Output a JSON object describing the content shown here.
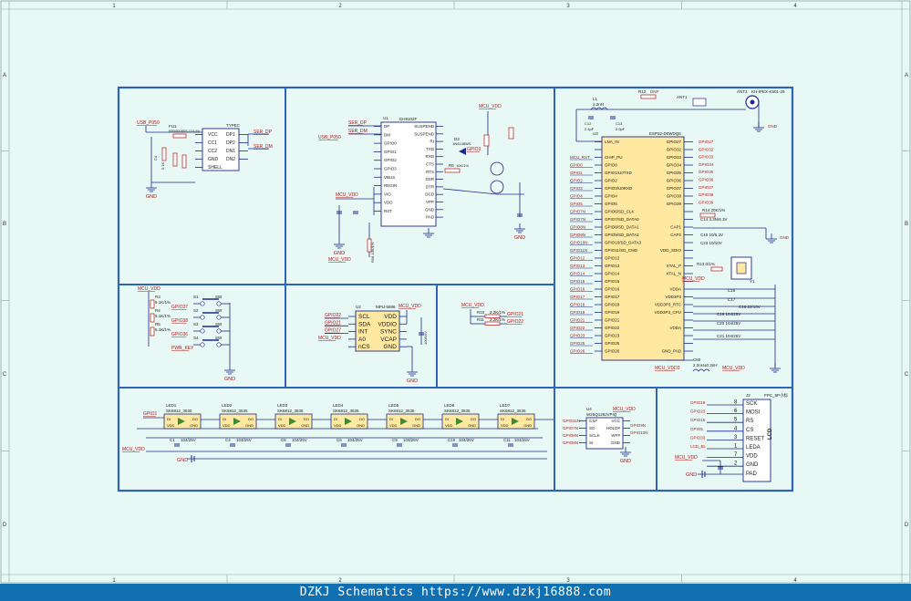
{
  "zones": {
    "columns": [
      "1",
      "2",
      "3",
      "4"
    ],
    "rows": [
      "A",
      "B",
      "C",
      "D"
    ]
  },
  "colors": {
    "background": "#e8f8f5",
    "frame": "#2f63b8",
    "wire": "#1c2a8c",
    "net_label": "#b01818",
    "chip_fill": "#ffe8a0",
    "footer_bg": "#0f6fb0"
  },
  "usb": {
    "connector_ref": "TYPEC",
    "pins_left": [
      "VCC",
      "CC1",
      "CC2",
      "GND",
      "SHELL"
    ],
    "pins_right": [
      "DP1",
      "DP2",
      "DN1",
      "DN2"
    ],
    "net_power": "USB_P050",
    "fuse_ref": "FU1",
    "fuse_part": "BSMD0805-110-6V",
    "net_dp": "SER_DP",
    "net_dm": "SER_DM",
    "gnd": "GND"
  },
  "ch9102": {
    "ref": "U1",
    "part": "CH9102F",
    "pins_left": [
      "DP",
      "DM",
      "GPIO0",
      "GPIO1",
      "GPIO2",
      "GPIO3",
      "VBUS",
      "REGIN",
      "VIO",
      "VDD",
      "RST"
    ],
    "pins_right": [
      "SUSPEND",
      "SUSPEND",
      "RI",
      "TXD",
      "RXD",
      "CTS",
      "RTS",
      "DSR",
      "DTR",
      "DCD",
      "VPP",
      "GND",
      "PAD"
    ],
    "net_dp": "SER_DP",
    "net_dm": "SER_DM",
    "net_power": "USB_P050",
    "net_vdd": "MCU_VDD",
    "diode_ref": "D3",
    "diode_part": "1N4148WS",
    "r_ref": "R6",
    "r_val": "10K/1%",
    "reset_r": "R58 10K/1%",
    "gnd": "GND"
  },
  "buttons": {
    "net_vdd": "MCU_VDD",
    "rows": [
      {
        "r": "R3",
        "rv": "5.1K/1%",
        "s": "S1",
        "net": "GPIO37",
        "label": "SW"
      },
      {
        "r": "R4",
        "rv": "5.1K/1%",
        "s": "S2",
        "net": "GPIO38",
        "label": "SW"
      },
      {
        "r": "R5",
        "rv": "5.1K/1%",
        "s": "S3",
        "net": "GPIO36",
        "label": "SW"
      },
      {
        "r": "",
        "rv": "",
        "s": "S4",
        "net": "PWR_KEY",
        "label": "SW"
      }
    ],
    "gnd": "GND"
  },
  "mpu": {
    "ref": "U2",
    "part": "MPU-6886",
    "pins_left": [
      "SCL",
      "SDA",
      "INT",
      "A0",
      "nCS"
    ],
    "pins_right": [
      "VDD",
      "VDDIO",
      "SYNC",
      "VCAP",
      "GND"
    ],
    "nets_left": [
      "GPIO22",
      "GPIO21",
      "GPIO27",
      "MCU_VDD"
    ],
    "net_vdd": "MCU_VDD",
    "cap": "100/10V",
    "gnd": "GND"
  },
  "i2c_pullups": {
    "net_vdd": "MCU_VDD",
    "rows": [
      {
        "r": "R10",
        "v": "2.2K/1%",
        "net": "GPIO21"
      },
      {
        "r": "R11",
        "v": "2.2K/1%",
        "net": "GPIO22"
      }
    ]
  },
  "esp32": {
    "ref": "U3",
    "part": "ESP32-D0WDQ6",
    "pins_left": [
      "LNA_IN",
      "",
      "CHIP_PU",
      "GPIO0",
      "GPIO1/U0TXD",
      "GPIO2",
      "GPIO3/U0RXD",
      "GPIO4",
      "GPIO5",
      "GPIO6/SD_CLK",
      "GPIO7/SD_DATA0",
      "GPIO8/SD_DATA1",
      "GPIO9/SD_DATA2",
      "GPIO10/SD_DATA3",
      "GPIO11/SD_CMD",
      "GPIO12",
      "GPIO13",
      "GPIO14",
      "GPIO15",
      "GPIO16",
      "GPIO17",
      "GPIO18",
      "GPIO19",
      "GPIO21",
      "GPIO22",
      "GPIO23",
      "GPIO25",
      "GPIO26"
    ],
    "nets_left": [
      "",
      "",
      "MCU_RST",
      "GPIO0",
      "GPIO1",
      "GPIO2",
      "GPIO3",
      "GPIO4",
      "GPIO5",
      "GPIO7N",
      "GPIO7N",
      "GPIO8N",
      "GPIO9N",
      "GPIO10N",
      "GPIO11N",
      "GPIO12",
      "GPIO13",
      "GPIO14",
      "GPIO15",
      "GPIO16",
      "GPIO17",
      "GPIO18",
      "GPIO19",
      "GPIO21",
      "GPIO22",
      "GPIO23",
      "GPIO25",
      "GPIO26"
    ],
    "pins_right": [
      "GPIO27",
      "GPIO32",
      "GPIO33",
      "GPIO34",
      "GPIO35",
      "GPIO36",
      "GPIO37",
      "GPIO38",
      "GPIO39",
      "",
      "",
      "CAP1",
      "CAP2",
      "",
      "VDD_SDIO",
      "",
      "XTAL_P",
      "XTAL_N",
      "",
      "VDDA",
      "VDD3P3",
      "VDD3P3_RTC",
      "VDD3P3_CPU",
      "",
      "VDDA",
      "",
      "",
      "GND_PAD"
    ],
    "nets_right": [
      "GPIO27",
      "GPIO32",
      "GPIO33",
      "GPIO34",
      "GPIO35",
      "GPIO36",
      "GPIO37",
      "GPIO38",
      "GPIO39"
    ],
    "passives": [
      "R14 20K/1%",
      "C14 3.3N/6.3V",
      "C15 10/6.3V",
      "C23 10/10V",
      "R13 0/1%",
      "C16",
      "C17",
      "C18 22/10V",
      "C19 104/25V",
      "C20 104/25V",
      "C21 104/25V",
      "C80",
      "2.2nH±0.3nH",
      "L1",
      "2.2nH",
      "C12",
      "2.4pF",
      "C13",
      "2.0pF",
      "R12",
      "DNP",
      "ANT1",
      "ANT2",
      "KH-IPEX-K501-29",
      "Y1"
    ],
    "net_vdd": "MCU_VDD",
    "net_vdd3": "MCU_VDD3",
    "gnd": "GND"
  },
  "leds": {
    "net_in": "GPIO1",
    "net_vdd": "MCU_VDD",
    "part": "SK6812_3535",
    "pins": [
      "DI",
      "DO",
      "VDD",
      "GND"
    ],
    "items": [
      {
        "ref": "LED1",
        "cap": "C1",
        "cv": "104/25V"
      },
      {
        "ref": "LED2",
        "cap": "C4",
        "cv": "104/25V"
      },
      {
        "ref": "LED3",
        "cap": "C5",
        "cv": "104/25V"
      },
      {
        "ref": "LED4",
        "cap": "C6",
        "cv": "104/25V"
      },
      {
        "ref": "LED5",
        "cap": "C9",
        "cv": "104/25V"
      },
      {
        "ref": "LED6",
        "cap": "C10",
        "cv": "104/25V"
      },
      {
        "ref": "LED7",
        "cap": "C11",
        "cv": "104/25V"
      }
    ],
    "gnd": "GND"
  },
  "flash": {
    "ref": "U4",
    "part": "W25Q128JVPIQ",
    "pins_left": [
      "CS#",
      "SO",
      "SCLK",
      "SI"
    ],
    "pins_right": [
      "VCC",
      "HOLD#",
      "WP#",
      "GND"
    ],
    "nets_left": [
      "GPIO11N",
      "GPIO7N",
      "GPIO6N",
      "GPIO8N"
    ],
    "nets_right": [
      "GPIO9N",
      "GPIO10N"
    ],
    "net_vdd": "MCU_VDD",
    "gnd": "GND"
  },
  "lcd": {
    "ref": "J2",
    "part": "FPC_8P小标",
    "label": "LCD",
    "pins": [
      {
        "num": "8",
        "name": "SCK",
        "net": "GPIO18"
      },
      {
        "num": "6",
        "name": "MOSI",
        "net": "GPIO23"
      },
      {
        "num": "5",
        "name": "RS",
        "net": "GPIO16"
      },
      {
        "num": "4",
        "name": "CS",
        "net": "GPIO5"
      },
      {
        "num": "3",
        "name": "RESET",
        "net": "GPIO33"
      },
      {
        "num": "1",
        "name": "LEDA",
        "net": "LCD_BL"
      },
      {
        "num": "7",
        "name": "VDD",
        "net": "MCU_VDD"
      },
      {
        "num": "2",
        "name": "GND",
        "net": "GND"
      },
      {
        "num": "",
        "name": "PAD",
        "net": ""
      }
    ],
    "gnd": "GND"
  },
  "footer": {
    "text": "DZKJ Schematics https://www.dzkj16888.com"
  }
}
